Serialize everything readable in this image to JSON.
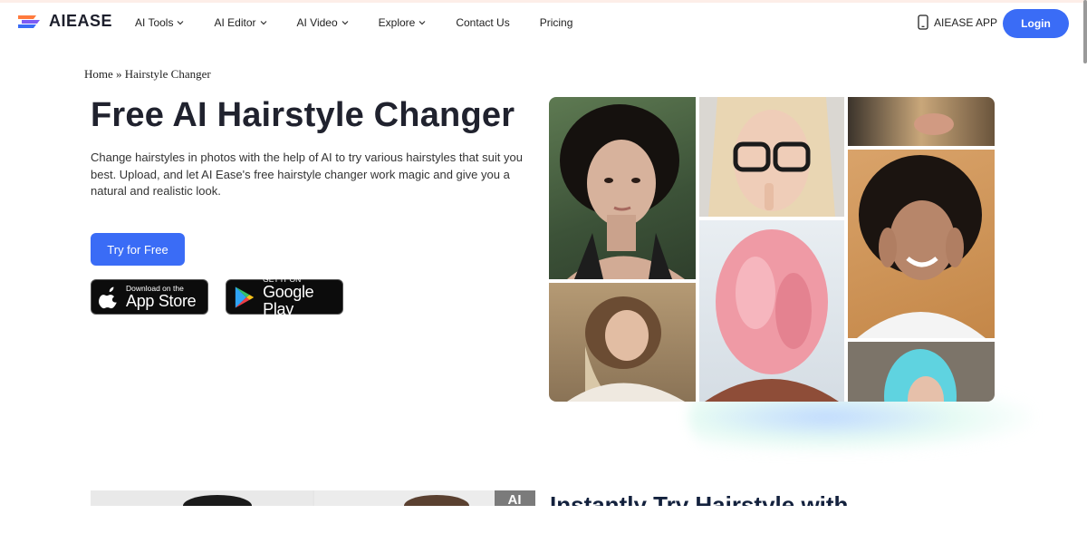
{
  "brand": {
    "name": "AIEASE"
  },
  "nav": {
    "items": [
      {
        "label": "AI Tools",
        "dropdown": true
      },
      {
        "label": "AI Editor",
        "dropdown": true
      },
      {
        "label": "AI Video",
        "dropdown": true
      },
      {
        "label": "Explore",
        "dropdown": true
      },
      {
        "label": "Contact Us",
        "dropdown": false
      },
      {
        "label": "Pricing",
        "dropdown": false
      }
    ],
    "app_label": "AIEASE APP",
    "login_label": "Login"
  },
  "breadcrumb": {
    "home": "Home",
    "separator": "»",
    "current": "Hairstyle Changer"
  },
  "hero": {
    "title": "Free AI Hairstyle Changer",
    "description": "Change hairstyles in photos with the help of AI to try various hairstyles that suit you best. Upload, and let AI Ease's free hairstyle changer work magic and give you a natural and realistic look.",
    "cta_label": "Try for Free",
    "appstore": {
      "small": "Download on the",
      "big": "App Store"
    },
    "googleplay": {
      "small": "GET IT ON",
      "big": "Google Play"
    }
  },
  "next_section": {
    "title": "Instantly Try Hairstyle with",
    "badge": "AI"
  },
  "colors": {
    "accent": "#3a6cf6",
    "text": "#20222e",
    "badge_bg": "#0c0c0c"
  },
  "icons": [
    "logo-mark-icon",
    "chevron-down-icon",
    "phone-icon",
    "apple-icon",
    "google-play-icon"
  ]
}
